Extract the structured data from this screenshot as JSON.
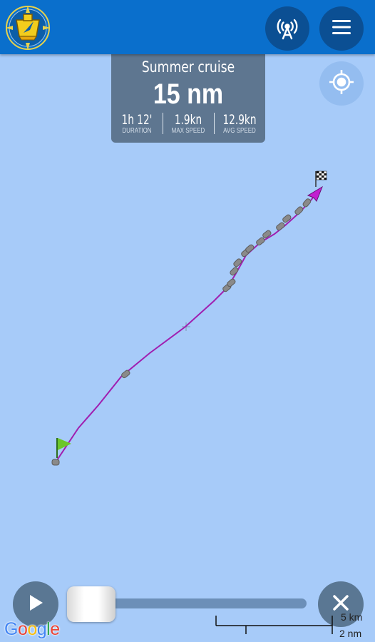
{
  "header": {
    "logo_icon": "ship-compass-logo-icon",
    "broadcast_icon": "antenna-broadcast-icon",
    "menu_icon": "hamburger-menu-icon",
    "background": "#0a6fcc"
  },
  "map": {
    "locate_icon": "my-location-icon",
    "track_color": "#a01fb0",
    "start_marker_icon": "green-flag-icon",
    "finish_marker_icon": "checkered-flag-icon"
  },
  "trip": {
    "name": "Summer cruise",
    "distance": "15 nm",
    "stats": [
      {
        "value": "1h 12'",
        "label": "DURATION"
      },
      {
        "value": "1.9kn",
        "label": "MAX SPEED"
      },
      {
        "value": "12.9kn",
        "label": "AVG SPEED"
      }
    ]
  },
  "playback": {
    "play_icon": "play-icon",
    "close_icon": "close-icon",
    "progress": 0
  },
  "attribution": {
    "google": "Google"
  },
  "scale": {
    "top_label": "5 km",
    "bottom_label": "2 nm"
  }
}
